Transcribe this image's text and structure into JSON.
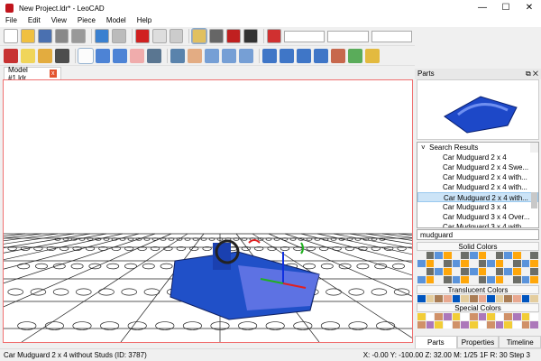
{
  "window": {
    "title": "New Project.ldr* - LeoCAD",
    "minimize": "—",
    "maximize": "☐",
    "close": "✕"
  },
  "menu": [
    "File",
    "Edit",
    "View",
    "Piece",
    "Model",
    "Help"
  ],
  "toolbar1": {
    "icons": [
      "new-icon",
      "open-icon",
      "save-icon",
      "print-icon",
      "print-preview-icon",
      "undo-icon",
      "redo-icon",
      "cut-icon",
      "copy-icon",
      "paste-icon",
      "relative-transform-icon",
      "snap-xy-icon",
      "snap-z-icon",
      "snap-angle-icon",
      "transform-icon"
    ]
  },
  "toolbar2": {
    "icons": [
      "insert-piece-icon",
      "light-icon",
      "spotlight-icon",
      "camera-icon",
      "select-icon",
      "move-icon",
      "rotate-icon",
      "delete-icon",
      "paint-icon",
      "zoom-icon",
      "pan-icon",
      "rotate-view-icon",
      "roll-icon",
      "zoom-region-icon",
      "first-step-icon",
      "previous-step-icon",
      "next-step-icon",
      "last-step-icon",
      "insert-step-icon",
      "remove-step-icon",
      "key-icon"
    ],
    "colors": [
      "#c01010",
      "#f0d040",
      "#e0a020",
      "#303030",
      "#ffffff",
      "#3070d0",
      "#3070d0",
      "#f0a0a0",
      "#406080",
      "#4070a0",
      "#e0a070",
      "#6090d0",
      "#6090d0",
      "#6090d0",
      "#2060c0",
      "#2060c0",
      "#2060c0",
      "#2060c0",
      "#c05030",
      "#40a040",
      "#e0b020"
    ]
  },
  "tab": {
    "label": "Model #1.ldr",
    "close": "x"
  },
  "panel": {
    "title": "Parts",
    "float": "⧉",
    "close": "✕",
    "tree_header": "Search Results",
    "items": [
      "Car Mudguard  2 x  4",
      "Car Mudguard  2 x  4 Swe...",
      "Car Mudguard  2 x  4 with...",
      "Car Mudguard  2 x  4 with...",
      "Car Mudguard  2 x  4 with...",
      "Car Mudguard  3 x  4",
      "Car Mudguard  3 x  4 Over...",
      "Car Mudguard  3 x  4 with..."
    ],
    "selected_index": 4,
    "search": "mudguard",
    "solid_label": "Solid Colors",
    "translucent_label": "Translucent Colors",
    "special_label": "Special Colors",
    "tabs": [
      "Parts",
      "Properties",
      "Timeline"
    ]
  },
  "status": {
    "left": "Car Mudguard  2 x  4 without Studs (ID: 3787)",
    "right": "X: -0.00 Y: -100.00 Z: 32.00   M: 1/25 1F R: 30   Step 3"
  }
}
